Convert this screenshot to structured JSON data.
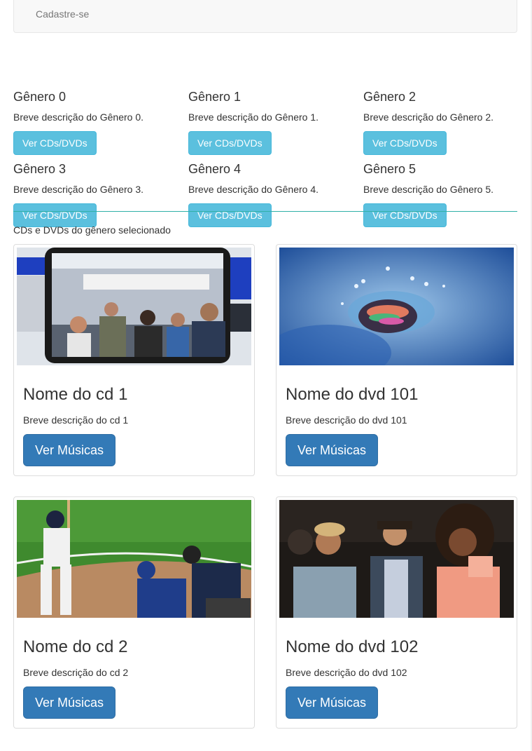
{
  "navbar": {
    "link_label": "Cadastre-se"
  },
  "genres": [
    {
      "title": "Gênero 0",
      "description": "Breve descrição do Gênero 0.",
      "button": "Ver CDs/DVDs"
    },
    {
      "title": "Gênero 1",
      "description": "Breve descrição do Gênero 1.",
      "button": "Ver CDs/DVDs"
    },
    {
      "title": "Gênero 2",
      "description": "Breve descrição do Gênero 2.",
      "button": "Ver CDs/DVDs"
    },
    {
      "title": "Gênero 3",
      "description": "Breve descrição do Gênero 3.",
      "button": "Ver CDs/DVDs"
    },
    {
      "title": "Gênero 4",
      "description": "Breve descrição do Gênero 4.",
      "button": "Ver CDs/DVDs"
    },
    {
      "title": "Gênero 5",
      "description": "Breve descrição do Gênero 5.",
      "button": "Ver CDs/DVDs"
    }
  ],
  "section_title": "CDs e DVDs do gênero selecionado",
  "items": [
    {
      "title": "Nome do cd 1",
      "description": "Breve descrição do cd 1",
      "button": "Ver Músicas",
      "image": "subway-passengers-photo"
    },
    {
      "title": "Nome do dvd 101",
      "description": "Breve descrição do dvd 101",
      "button": "Ver Músicas",
      "image": "water-splash-photo"
    },
    {
      "title": "Nome do cd 2",
      "description": "Breve descrição do cd 2",
      "button": "Ver Músicas",
      "image": "baseball-batter-photo"
    },
    {
      "title": "Nome do dvd 102",
      "description": "Breve descrição do dvd 102",
      "button": "Ver Músicas",
      "image": "people-party-photo"
    }
  ],
  "colors": {
    "info": "#5bc0de",
    "primary": "#337ab7",
    "divider": "#31b0a8"
  }
}
